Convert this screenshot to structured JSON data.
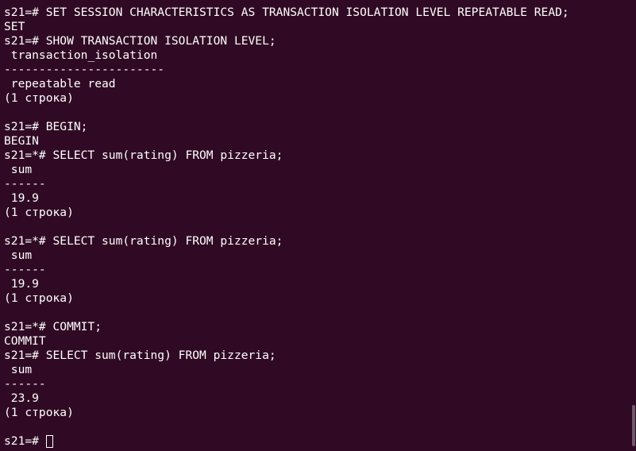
{
  "terminal": {
    "lines": [
      "s21=# SET SESSION CHARACTERISTICS AS TRANSACTION ISOLATION LEVEL REPEATABLE READ;",
      "SET",
      "s21=# SHOW TRANSACTION ISOLATION LEVEL;",
      " transaction_isolation",
      "-----------------------",
      " repeatable read",
      "(1 строка)",
      "",
      "s21=# BEGIN;",
      "BEGIN",
      "s21=*# SELECT sum(rating) FROM pizzeria;",
      " sum",
      "------",
      " 19.9",
      "(1 строка)",
      "",
      "s21=*# SELECT sum(rating) FROM pizzeria;",
      " sum",
      "------",
      " 19.9",
      "(1 строка)",
      "",
      "s21=*# COMMIT;",
      "COMMIT",
      "s21=# SELECT sum(rating) FROM pizzeria;",
      " sum",
      "------",
      " 23.9",
      "(1 строка)",
      ""
    ],
    "prompt": "s21=# "
  },
  "colors": {
    "background": "#300a24",
    "foreground": "#ffffff"
  }
}
